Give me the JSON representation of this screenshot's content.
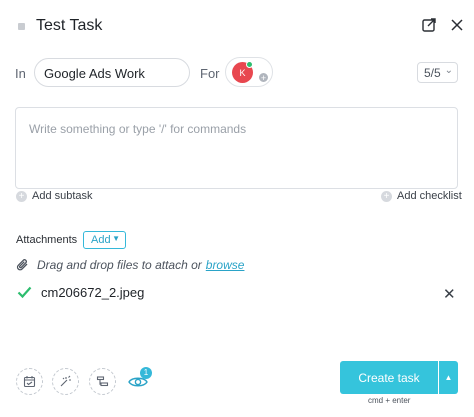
{
  "task": {
    "title": "Test Task"
  },
  "header": {
    "icons": [
      "open-in-new-icon",
      "close-icon"
    ]
  },
  "location": {
    "in_label": "In",
    "list_name": "Google Ads Work",
    "for_label": "For"
  },
  "assignee": {
    "initial": "K"
  },
  "priority": {
    "value": "5/5"
  },
  "description": {
    "placeholder": "Write something or type '/' for commands"
  },
  "actions": {
    "add_subtask": "Add subtask",
    "add_checklist": "Add checklist"
  },
  "attachments": {
    "label": "Attachments",
    "add_button": "Add",
    "drop_text": "Drag and drop files to attach or",
    "browse_link": "browse",
    "files": [
      {
        "name": "cm206672_2.jpeg",
        "status": "uploaded"
      }
    ]
  },
  "toolbar": {
    "icons": [
      "calendar-icon",
      "magic-wand-icon",
      "gantt-icon",
      "eye-icon"
    ],
    "watcher_count": "1"
  },
  "footer": {
    "create_button": "Create task",
    "shortcut": "cmd + enter"
  },
  "colors": {
    "accent": "#35c4dc",
    "avatar": "#e8474f",
    "success": "#2dbd6e"
  }
}
